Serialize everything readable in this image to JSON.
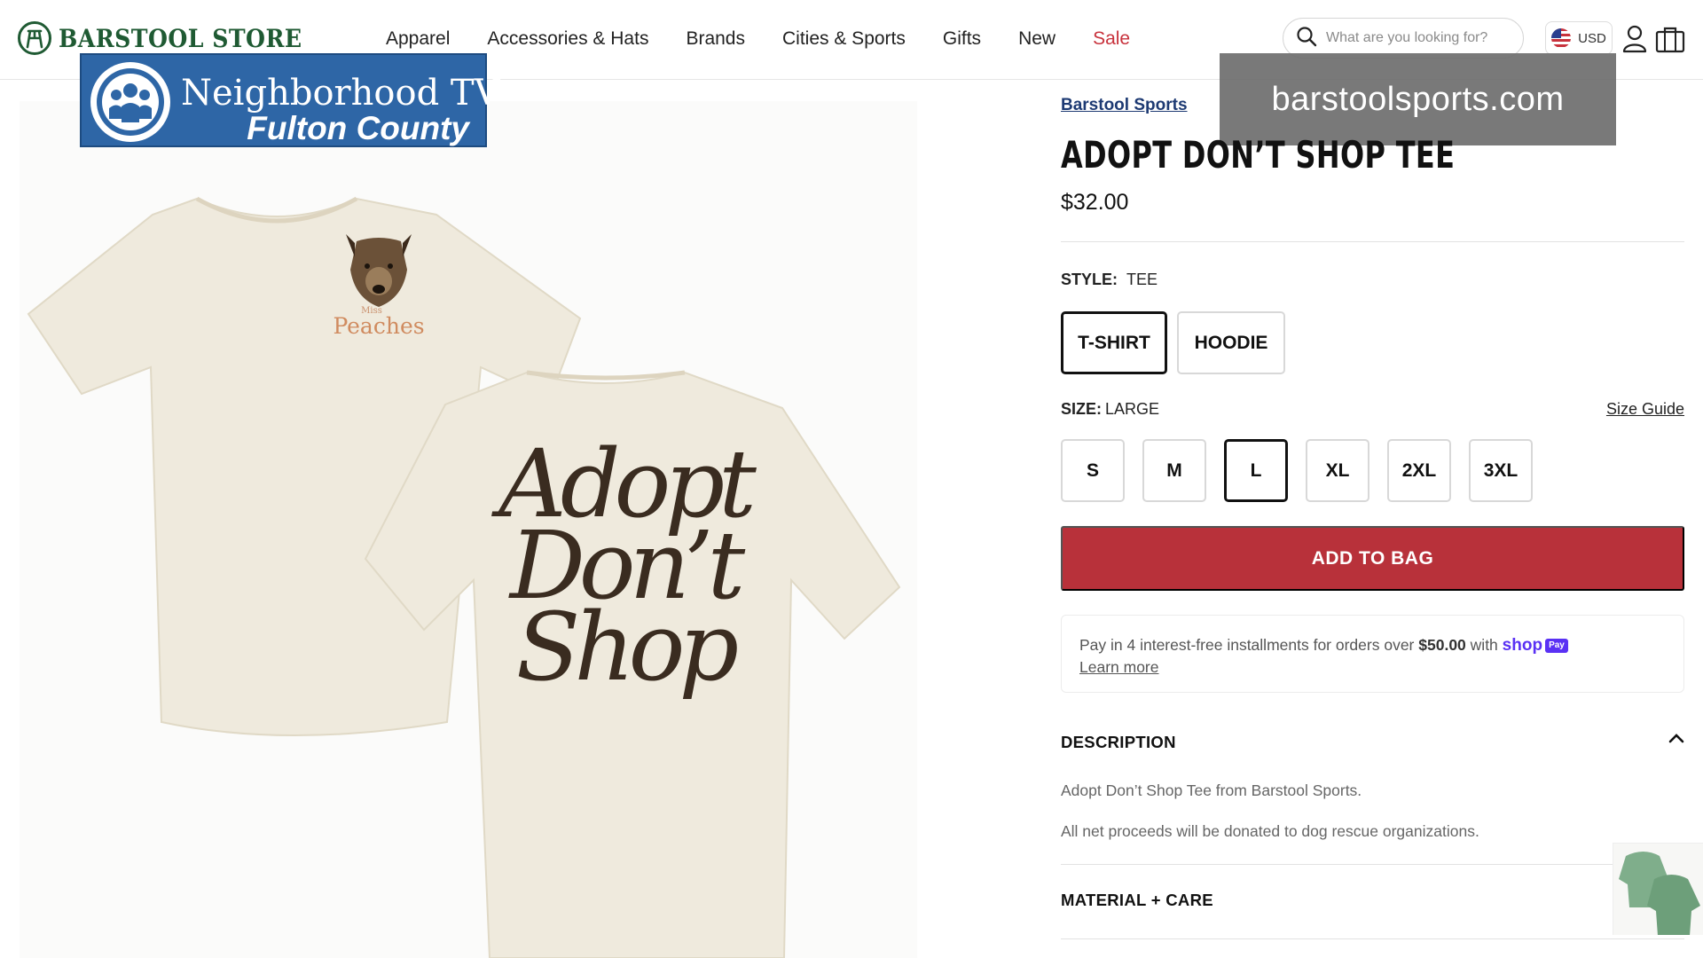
{
  "header": {
    "logo_text": "BARSTOOL STORE",
    "nav": [
      {
        "label": "Apparel",
        "sale": false
      },
      {
        "label": "Accessories & Hats",
        "sale": false
      },
      {
        "label": "Brands",
        "sale": false
      },
      {
        "label": "Cities & Sports",
        "sale": false
      },
      {
        "label": "Gifts",
        "sale": false
      },
      {
        "label": "New",
        "sale": false
      },
      {
        "label": "Sale",
        "sale": true
      }
    ],
    "search_placeholder": "What are you looking for?",
    "currency": "USD",
    "icons": {
      "search": "search-icon",
      "flag": "us-flag-icon",
      "account": "user-icon",
      "bag": "shopping-bag-icon"
    }
  },
  "overlays": {
    "tv_badge_line1": "Neighborhood TV",
    "tv_badge_line2": "Fulton County",
    "url_banner": "barstoolsports.com"
  },
  "product": {
    "brand_link": "Barstool Sports",
    "title": "ADOPT DON’T SHOP TEE",
    "price": "$32.00",
    "style_label": "STYLE:",
    "style_value": "TEE",
    "styles": [
      {
        "label": "T-SHIRT",
        "selected": true
      },
      {
        "label": "HOODIE",
        "selected": false
      }
    ],
    "size_label": "SIZE:",
    "size_value": "LARGE",
    "size_guide": "Size Guide",
    "sizes": [
      {
        "label": "S",
        "selected": false
      },
      {
        "label": "M",
        "selected": false
      },
      {
        "label": "L",
        "selected": true
      },
      {
        "label": "XL",
        "selected": false
      },
      {
        "label": "2XL",
        "selected": false
      },
      {
        "label": "3XL",
        "selected": false
      }
    ],
    "add_to_bag": "ADD TO BAG",
    "installments": {
      "text_before": "Pay in 4 interest-free installments for orders over",
      "threshold": "$50.00",
      "text_with": "with",
      "shop_logo": "shop",
      "shop_pay_badge": "Pay",
      "learn_more": "Learn more"
    },
    "description_heading": "DESCRIPTION",
    "description_lines": [
      "Adopt Don’t Shop Tee from Barstool Sports.",
      "All net proceeds will be donated to dog rescue organizations."
    ],
    "material_heading": "MATERIAL + CARE"
  },
  "image_text": {
    "front_pet_name_small": "Miss",
    "front_pet_name": "Peaches",
    "back_line1": "Adopt",
    "back_line2": "Don’t",
    "back_line3": "Shop"
  },
  "colors": {
    "brand_green": "#1f5a33",
    "sale_red": "#c8323c",
    "add_to_bag": "#b8313a",
    "link_navy": "#1d3a73",
    "shop_pay_purple": "#5a31f4",
    "tv_blue": "#2e66a6",
    "shirt_cream": "#efeadd",
    "print_brown": "#3a2c20"
  }
}
